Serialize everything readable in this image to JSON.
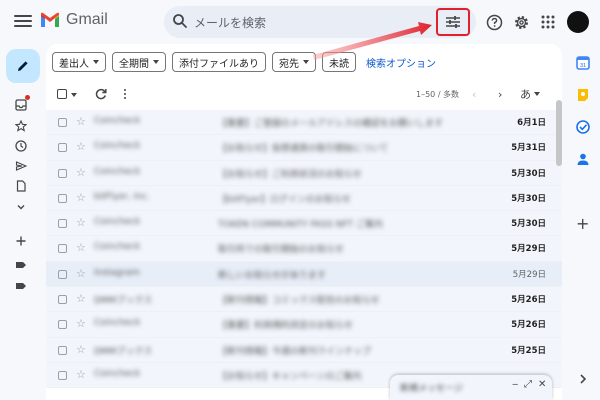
{
  "app": {
    "name": "Gmail"
  },
  "search": {
    "placeholder": "メールを検索"
  },
  "filter_chips": [
    {
      "label": "差出人",
      "has_caret": true
    },
    {
      "label": "全期間",
      "has_caret": true
    },
    {
      "label": "添付ファイルあり",
      "has_caret": false
    },
    {
      "label": "宛先",
      "has_caret": true
    },
    {
      "label": "未読",
      "has_caret": false
    }
  ],
  "advanced_search_label": "検索オプション",
  "pagination": {
    "range": "1–50 / 多数"
  },
  "lang_toggle": "あ",
  "emails": [
    {
      "sender": "Coincheck",
      "subject": "【重要】ご登録のメールアドレスの確認をお願いします",
      "date": "6月1日",
      "unread": true
    },
    {
      "sender": "Coincheck",
      "subject": "【お知らせ】仮想通貨の取引開始について",
      "date": "5月31日",
      "unread": true
    },
    {
      "sender": "Coincheck",
      "subject": "【お知らせ】ご利用状況のお知らせ",
      "date": "5月30日",
      "unread": true
    },
    {
      "sender": "bitFlyer, Inc.",
      "subject": "【bitFlyer】ログインのお知らせ",
      "date": "5月30日",
      "unread": true
    },
    {
      "sender": "Coincheck",
      "subject": "TOKEN COMMUNITY PASS NFT ご案内",
      "date": "5月30日",
      "unread": true
    },
    {
      "sender": "Coincheck",
      "subject": "取引所での取引開始のお知らせ",
      "date": "5月29日",
      "unread": true
    },
    {
      "sender": "Instagram",
      "subject": "新しいお知らせがあります",
      "date": "5月29日",
      "unread": false
    },
    {
      "sender": "DMMブックス",
      "subject": "【新刊情報】コミックス配信のお知らせ",
      "date": "5月26日",
      "unread": true
    },
    {
      "sender": "Coincheck",
      "subject": "【重要】利用規約改定のお知らせ",
      "date": "5月26日",
      "unread": true
    },
    {
      "sender": "DMMブックス",
      "subject": "【新刊情報】今週の新刊ラインナップ",
      "date": "5月25日",
      "unread": true
    },
    {
      "sender": "Coincheck",
      "subject": "【お知らせ】キャンペーンのご案内",
      "date": "",
      "unread": true
    }
  ],
  "chat_popup": {
    "title": "新規メッセージ"
  },
  "colors": {
    "accent_red": "#e0202b",
    "compose_bg": "#c2e7ff",
    "link_blue": "#0b57d0"
  },
  "icons": {
    "menu": "hamburger-icon",
    "search": "search-icon",
    "filter": "tune-icon",
    "help": "help-icon",
    "settings": "gear-icon",
    "apps": "apps-grid-icon",
    "compose": "pencil-icon"
  }
}
